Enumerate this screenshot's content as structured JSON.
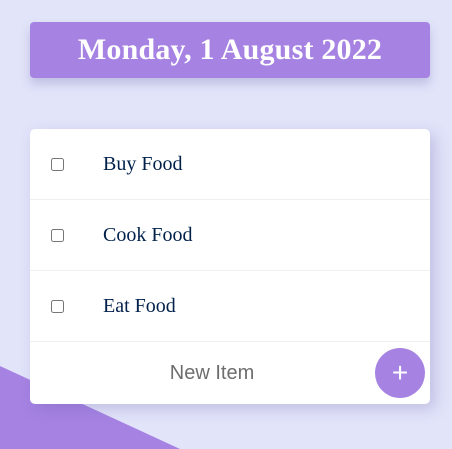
{
  "heading": {
    "date": "Monday, 1 August 2022"
  },
  "items": [
    {
      "text": "Buy Food",
      "checked": false
    },
    {
      "text": "Cook Food",
      "checked": false
    },
    {
      "text": "Eat Food",
      "checked": false
    }
  ],
  "form": {
    "placeholder": "New Item",
    "value": "",
    "add_label": "+"
  },
  "colors": {
    "background": "#E2E4FA",
    "accent": "#A683E3",
    "item_text": "#00204A"
  }
}
